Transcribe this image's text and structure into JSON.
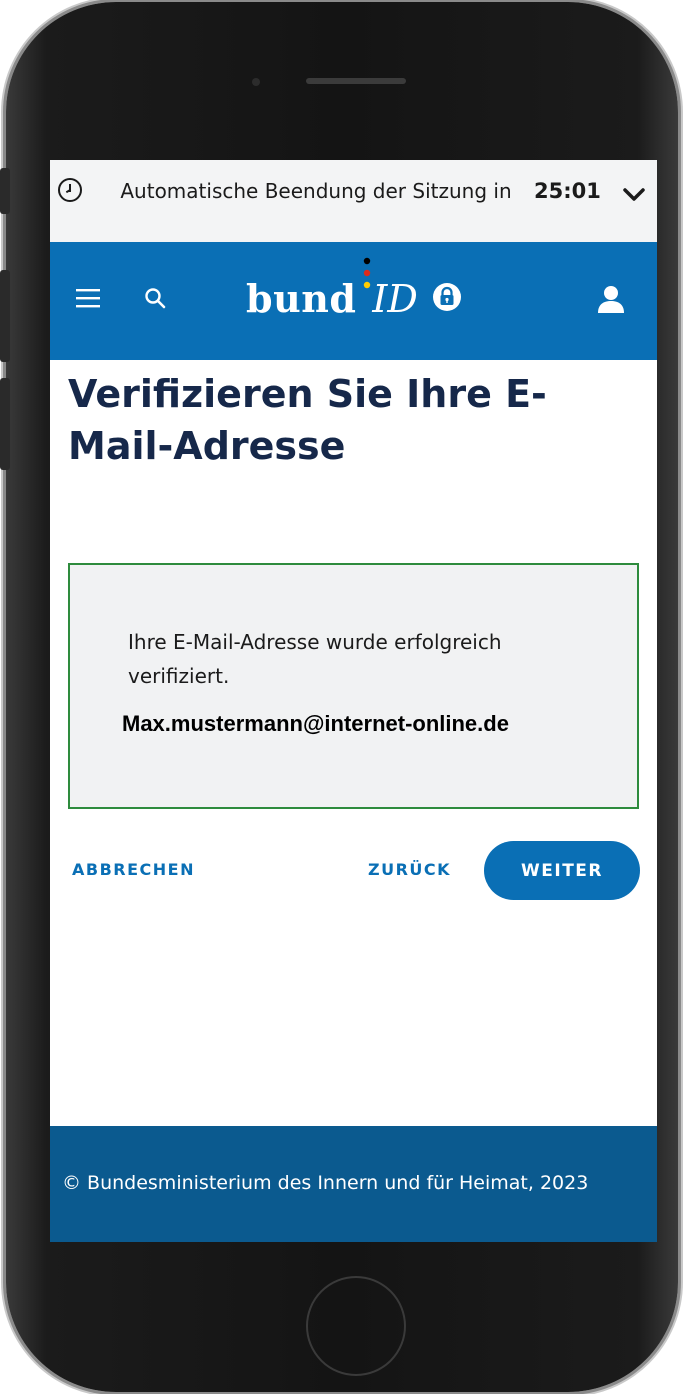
{
  "session": {
    "text": "Automatische Beendung der Sitzung in",
    "time": "25:01",
    "icon": "clock-icon",
    "toggle_icon": "chevron-down-icon"
  },
  "header": {
    "logo_main": "bund",
    "logo_id": "ID",
    "icons": [
      "menu-icon",
      "search-icon",
      "lock-icon",
      "user-icon"
    ],
    "background_color": "#0a6fb5"
  },
  "page": {
    "title": "Verifizieren Sie Ihre E-Mail-Adresse"
  },
  "success_box": {
    "message": "Ihre E-Mail-Adresse wurde erfolgreich verifiziert.",
    "email": "Max.mustermann@internet-online.de",
    "border_color": "#2e8b3d"
  },
  "actions": {
    "cancel_label": "ABBRECHEN",
    "back_label": "ZURÜCK",
    "next_label": "WEITER"
  },
  "footer": {
    "text": "© Bundesministerium des Innern und für Heimat, 2023",
    "background_color": "#0b5a8f"
  }
}
